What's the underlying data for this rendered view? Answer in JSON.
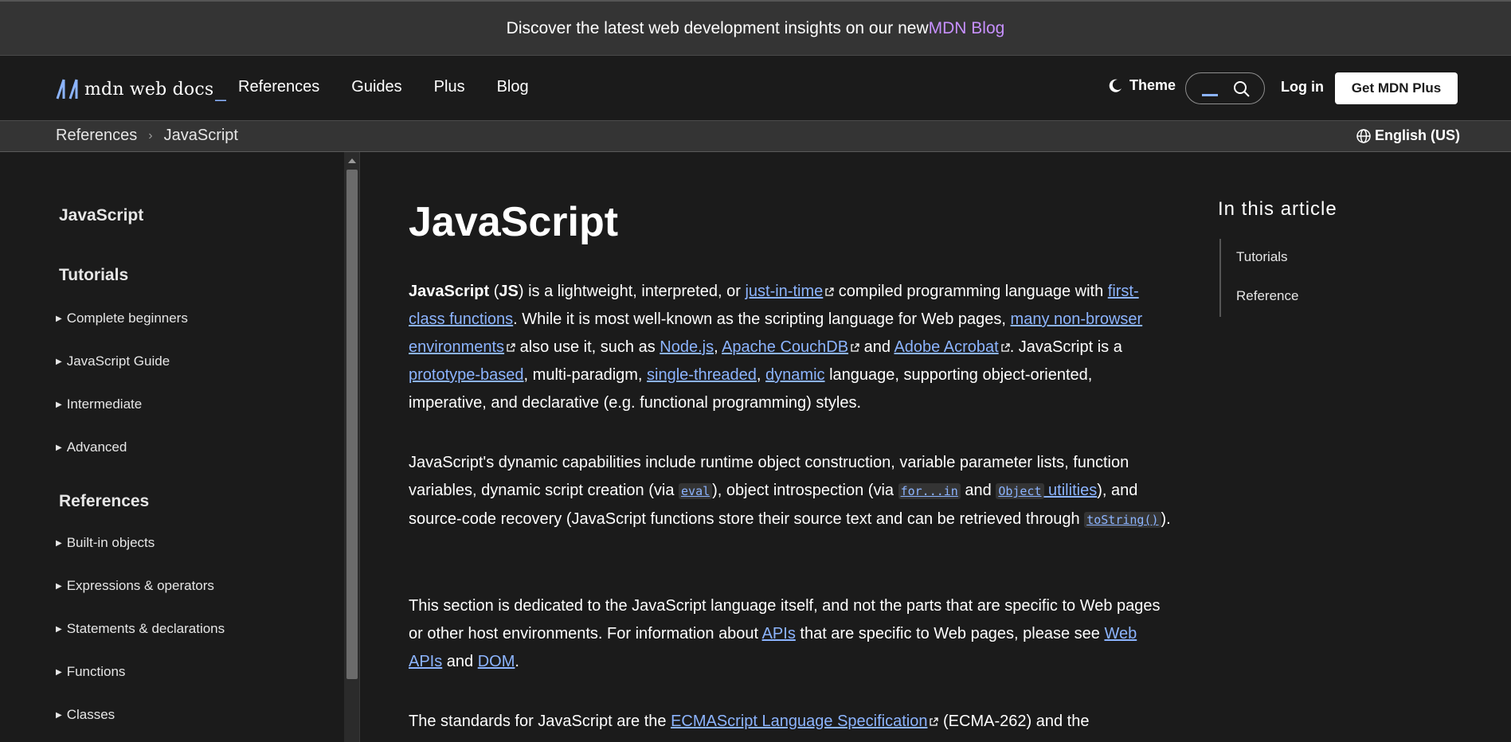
{
  "banner": {
    "text": "Discover the latest web development insights on our new ",
    "link": "MDN Blog"
  },
  "header": {
    "logo_text": "mdn web docs",
    "logo_underscore": "_",
    "nav": [
      "References",
      "Guides",
      "Plus",
      "Blog"
    ],
    "theme_label": "Theme",
    "login_label": "Log in",
    "plus_button": "Get MDN Plus"
  },
  "breadcrumb": {
    "items": [
      "References",
      "JavaScript"
    ],
    "language": "English (US)"
  },
  "sidebar": {
    "title": "JavaScript",
    "tutorials_heading": "Tutorials",
    "tutorials": [
      "Complete beginners",
      "JavaScript Guide",
      "Intermediate",
      "Advanced"
    ],
    "references_heading": "References",
    "references": [
      "Built-in objects",
      "Expressions & operators",
      "Statements & declarations",
      "Functions",
      "Classes"
    ]
  },
  "article": {
    "title": "JavaScript",
    "p1": {
      "bold1": "JavaScript",
      "t1": " (",
      "bold2": "JS",
      "t2": ") is a lightweight, interpreted, or ",
      "l1": "just-in-time",
      "t3": " compiled programming language with ",
      "l2": "first-class functions",
      "t4": ". While it is most well-known as the scripting language for Web pages, ",
      "l3": "many non-browser environments",
      "t5": " also use it, such as ",
      "l4": "Node.js",
      "t6": ", ",
      "l5": "Apache CouchDB",
      "t7": " and ",
      "l6": "Adobe Acrobat",
      "t8": ". JavaScript is a ",
      "l7": "prototype-based",
      "t9": ", multi-paradigm, ",
      "l8": "single-threaded",
      "t10": ", ",
      "l9": "dynamic",
      "t11": " language, supporting object-oriented, imperative, and declarative (e.g. functional programming) styles."
    },
    "p2": {
      "t1": "JavaScript's dynamic capabilities include runtime object construction, variable parameter lists, function variables, dynamic script creation (via ",
      "c1": "eval",
      "t2": "), object introspection (via ",
      "c2": "for...in",
      "t3": " and ",
      "c3": "Object",
      "l1": " utilities",
      "t4": "), and source-code recovery (JavaScript functions store their source text and can be retrieved through ",
      "c4": "toString()",
      "t5": ")."
    },
    "p3": {
      "t1": "This section is dedicated to the JavaScript language itself, and not the parts that are specific to Web pages or other host environments. For information about ",
      "l1": "APIs",
      "t2": " that are specific to Web pages, please see ",
      "l2": "Web APIs",
      "t3": " and ",
      "l3": "DOM",
      "t4": "."
    },
    "p4": {
      "t1": "The standards for JavaScript are the ",
      "l1": "ECMAScript Language Specification",
      "t2": " (ECMA-262) and the"
    }
  },
  "toc": {
    "heading": "In this article",
    "items": [
      "Tutorials",
      "Reference"
    ]
  },
  "colors": {
    "background": "#1b1b1b",
    "banner": "#343434",
    "link": "#8cb4ff",
    "banner_link": "#c790ff"
  }
}
